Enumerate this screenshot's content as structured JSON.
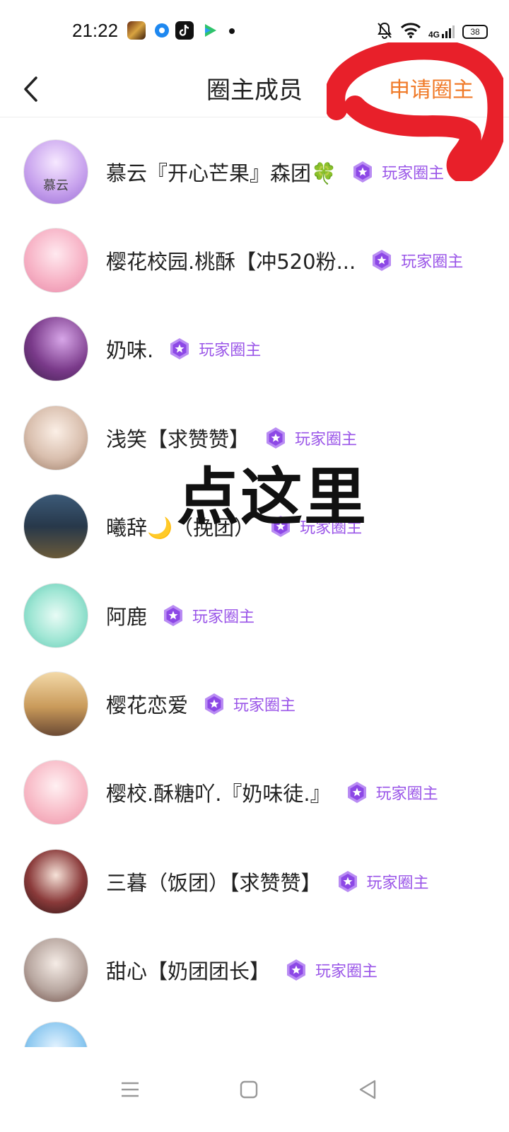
{
  "status_bar": {
    "time": "21:22",
    "network": "4G",
    "battery": "38",
    "icons": [
      "game-app-icon",
      "qq-browser-icon",
      "tiktok-icon",
      "video-app-icon",
      "mute-icon",
      "wifi-icon",
      "signal-icon",
      "battery-icon"
    ]
  },
  "header": {
    "title": "圈主成员",
    "apply_label": "申请圈主"
  },
  "badge_label": "玩家圈主",
  "annotation": {
    "text": "点这里"
  },
  "colors": {
    "accent_orange": "#f07a28",
    "badge_purple": "#9a55e8",
    "annotation_red": "#e8202a"
  },
  "members": [
    {
      "name": "慕云『开心芒果』森团🍀",
      "badge": "玩家圈主",
      "avatar_text": "慕云"
    },
    {
      "name": "樱花校园.桃酥【冲520粉...",
      "badge": "玩家圈主"
    },
    {
      "name": "奶味.",
      "badge": "玩家圈主"
    },
    {
      "name": "浅笑【求赞赞】",
      "badge": "玩家圈主"
    },
    {
      "name": "曦辞🌙（挽团）",
      "badge": "玩家圈主"
    },
    {
      "name": "阿鹿",
      "badge": "玩家圈主"
    },
    {
      "name": "樱花恋爱",
      "badge": "玩家圈主"
    },
    {
      "name": "樱校.酥糖吖.『奶味徒.』",
      "badge": "玩家圈主"
    },
    {
      "name": "三暮（饭团）【求赞赞】",
      "badge": "玩家圈主"
    },
    {
      "name": "甜心【奶团团长】",
      "badge": "玩家圈主"
    }
  ]
}
